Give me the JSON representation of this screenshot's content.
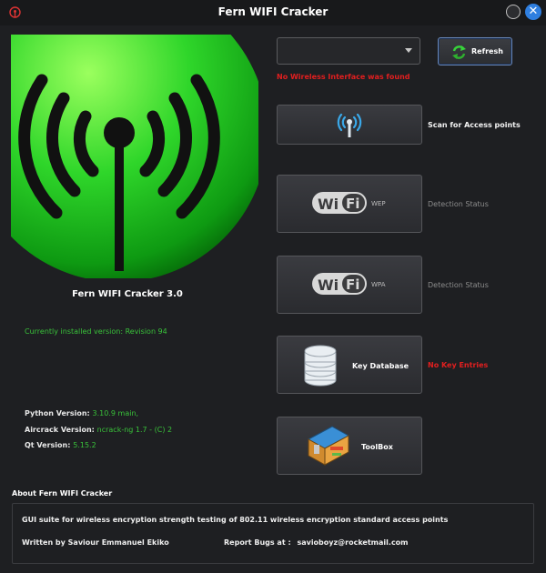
{
  "window": {
    "title": "Fern WIFI Cracker",
    "close_glyph": "✕"
  },
  "left": {
    "app_name": "Fern WIFI Cracker 3.0",
    "installed_version": "Currently installed version: Revision 94",
    "python_label": "Python Version:",
    "python_value": "3.10.9 main,",
    "aircrack_label": "Aircrack Version:",
    "aircrack_value": "ncrack-ng 1.7 - (C) 2",
    "qt_label": "Qt Version:",
    "qt_value": "5.15.2"
  },
  "interface": {
    "selected": "",
    "error": "No Wireless Interface was found"
  },
  "buttons": {
    "refresh": "Refresh",
    "wep": "WEP",
    "wpa": "WPA",
    "key_database": "Key Database",
    "toolbox": "ToolBox"
  },
  "labels": {
    "scan": "Scan for Access points",
    "wep_status": "Detection Status",
    "wpa_status": "Detection Status",
    "key_entries": "No Key Entries"
  },
  "about": {
    "title": "About Fern WIFI Cracker",
    "description": "GUI suite for wireless  encryption strength testing of 802.11 wireless encryption standard access points",
    "author": "Written by Saviour Emmanuel Ekiko",
    "bugs_label": "Report Bugs at :",
    "bugs_email": "savioboyz@rocketmail.com"
  },
  "colors": {
    "accent_green": "#39c23a",
    "error_red": "#e21f1f",
    "close_blue": "#2f7fe0",
    "background": "#1e1f22"
  },
  "icons": [
    "app-icon",
    "refresh-icon",
    "antenna-icon",
    "wifi-logo-icon",
    "database-icon",
    "toolbox-icon",
    "window-close-icon"
  ]
}
